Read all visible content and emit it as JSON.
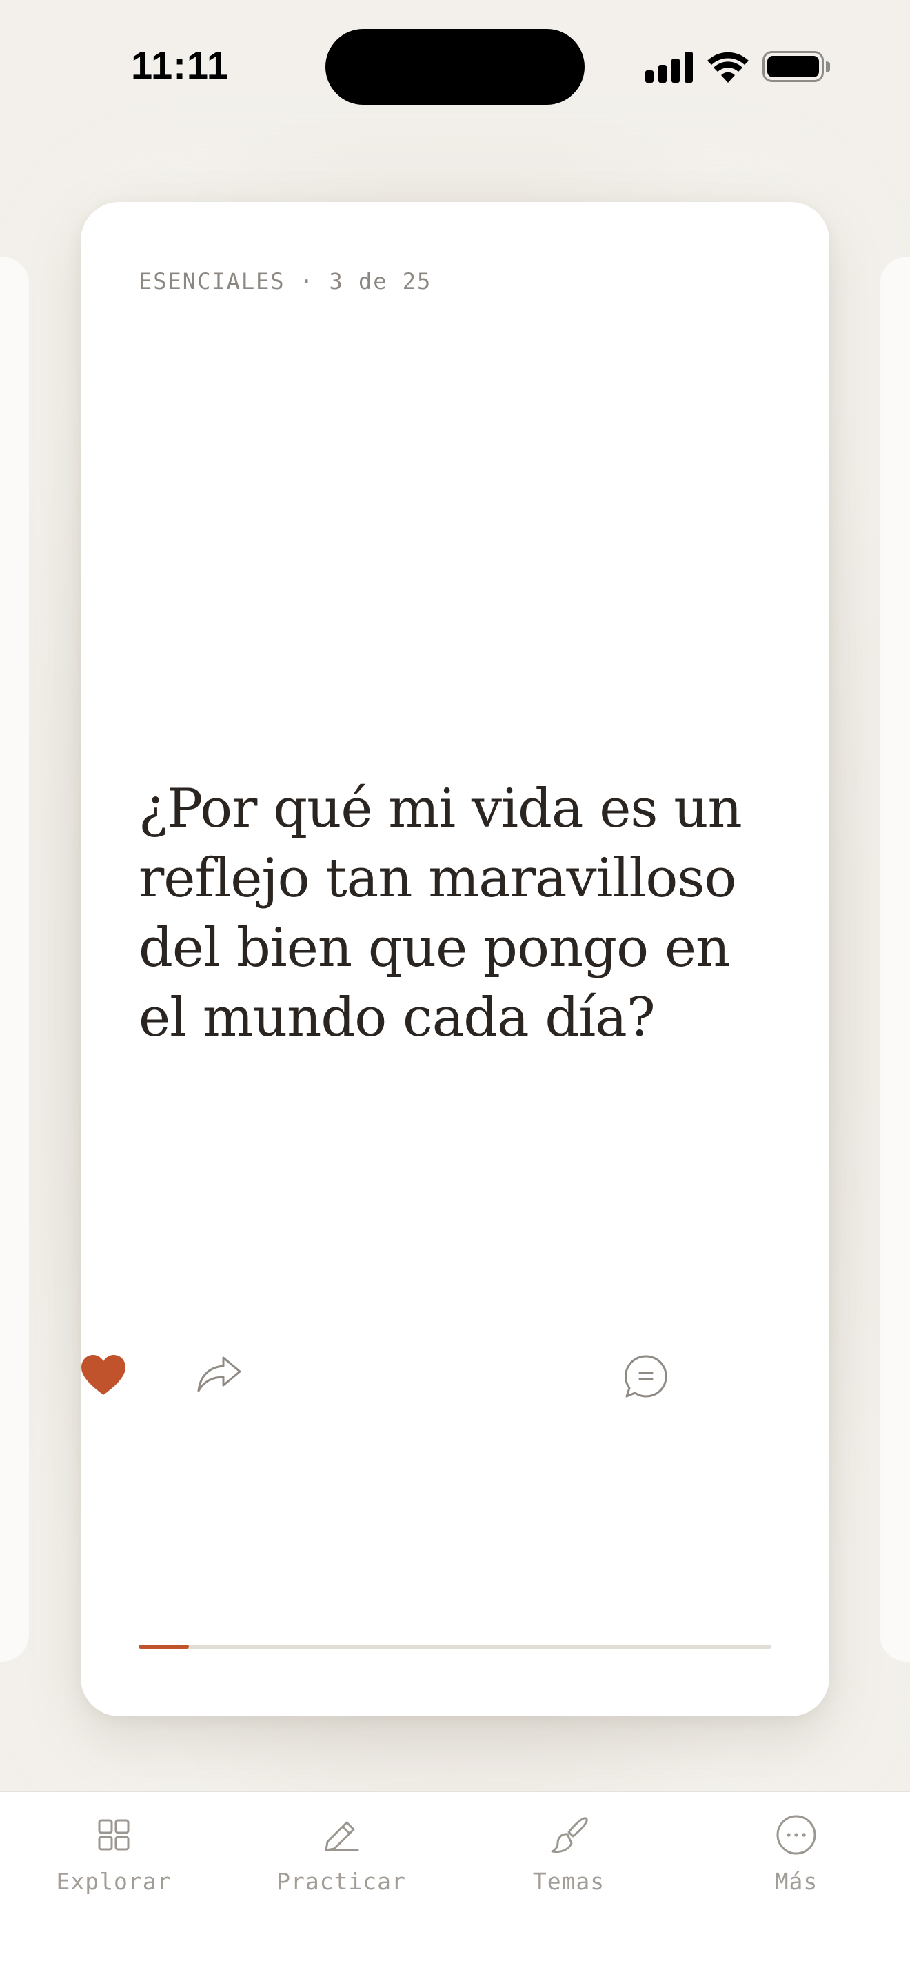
{
  "status_bar": {
    "time": "11:11"
  },
  "card": {
    "collection": "ESENCIALES",
    "position": "3 de 25",
    "meta_separator": "·",
    "question": "¿Por qué mi vida es un reflejo tan maravilloso del bien que pongo en el mundo cada día?",
    "progress_fraction": 0.08,
    "favorited": true,
    "accent_color": "#c0532c",
    "actions": {
      "favorite_icon": "heart-icon",
      "share_icon": "share-icon",
      "comment_icon": "comment-icon"
    }
  },
  "tabbar": {
    "tabs": [
      {
        "label": "Explorar",
        "icon": "grid-icon"
      },
      {
        "label": "Practicar",
        "icon": "pencil-icon"
      },
      {
        "label": "Temas",
        "icon": "paintbrush-icon"
      },
      {
        "label": "Más",
        "icon": "more-icon"
      }
    ]
  }
}
